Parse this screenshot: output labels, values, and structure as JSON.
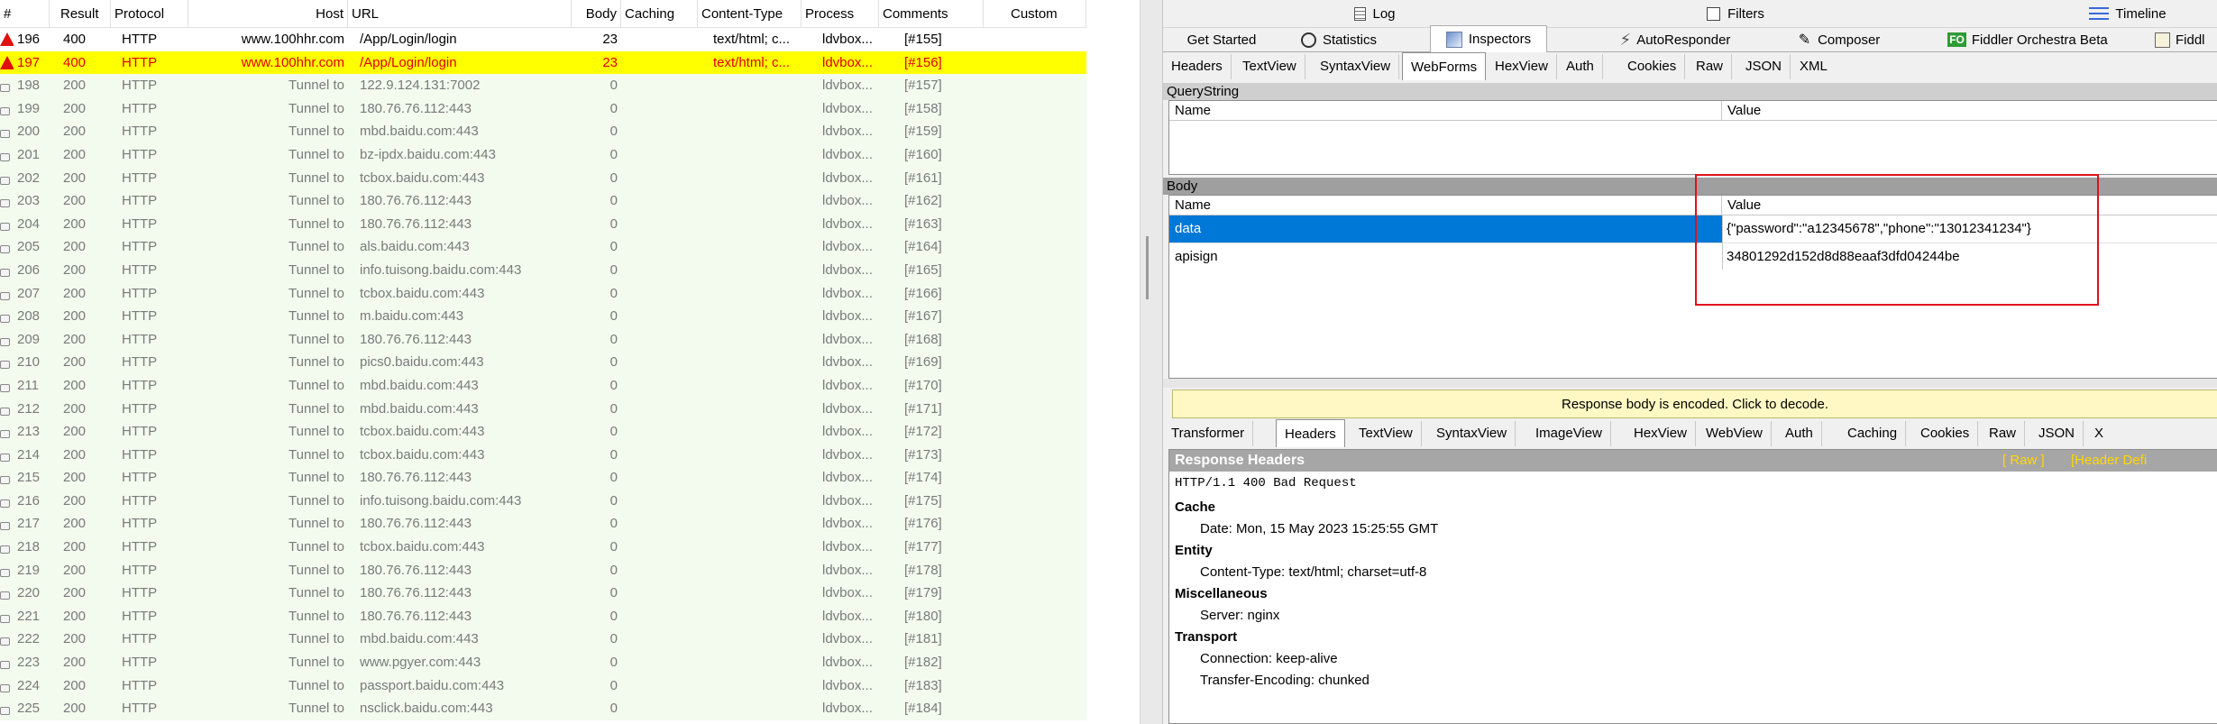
{
  "sessions": {
    "columns": [
      "#",
      "Result",
      "Protocol",
      "Host",
      "URL",
      "Body",
      "Caching",
      "Content-Type",
      "Process",
      "Comments",
      "Custom"
    ],
    "rows": [
      {
        "num": "196",
        "result": "400",
        "protocol": "HTTP",
        "host": "www.100hhr.com",
        "url": "/App/Login/login",
        "body": "23",
        "caching": "",
        "content_type": "text/html; c...",
        "process": "ldvbox...",
        "comments": "[#155]",
        "status": "error"
      },
      {
        "num": "197",
        "result": "400",
        "protocol": "HTTP",
        "host": "www.100hhr.com",
        "url": "/App/Login/login",
        "body": "23",
        "caching": "",
        "content_type": "text/html; c...",
        "process": "ldvbox...",
        "comments": "[#156]",
        "status": "selected"
      },
      {
        "num": "198",
        "result": "200",
        "protocol": "HTTP",
        "host": "Tunnel to",
        "url": "122.9.124.131:7002",
        "body": "0",
        "caching": "",
        "content_type": "",
        "process": "ldvbox...",
        "comments": "[#157]",
        "status": "tunnel"
      },
      {
        "num": "199",
        "result": "200",
        "protocol": "HTTP",
        "host": "Tunnel to",
        "url": "180.76.76.112:443",
        "body": "0",
        "caching": "",
        "content_type": "",
        "process": "ldvbox...",
        "comments": "[#158]",
        "status": "tunnel"
      },
      {
        "num": "200",
        "result": "200",
        "protocol": "HTTP",
        "host": "Tunnel to",
        "url": "mbd.baidu.com:443",
        "body": "0",
        "caching": "",
        "content_type": "",
        "process": "ldvbox...",
        "comments": "[#159]",
        "status": "tunnel"
      },
      {
        "num": "201",
        "result": "200",
        "protocol": "HTTP",
        "host": "Tunnel to",
        "url": "bz-ipdx.baidu.com:443",
        "body": "0",
        "caching": "",
        "content_type": "",
        "process": "ldvbox...",
        "comments": "[#160]",
        "status": "tunnel"
      },
      {
        "num": "202",
        "result": "200",
        "protocol": "HTTP",
        "host": "Tunnel to",
        "url": "tcbox.baidu.com:443",
        "body": "0",
        "caching": "",
        "content_type": "",
        "process": "ldvbox...",
        "comments": "[#161]",
        "status": "tunnel"
      },
      {
        "num": "203",
        "result": "200",
        "protocol": "HTTP",
        "host": "Tunnel to",
        "url": "180.76.76.112:443",
        "body": "0",
        "caching": "",
        "content_type": "",
        "process": "ldvbox...",
        "comments": "[#162]",
        "status": "tunnel"
      },
      {
        "num": "204",
        "result": "200",
        "protocol": "HTTP",
        "host": "Tunnel to",
        "url": "180.76.76.112:443",
        "body": "0",
        "caching": "",
        "content_type": "",
        "process": "ldvbox...",
        "comments": "[#163]",
        "status": "tunnel"
      },
      {
        "num": "205",
        "result": "200",
        "protocol": "HTTP",
        "host": "Tunnel to",
        "url": "als.baidu.com:443",
        "body": "0",
        "caching": "",
        "content_type": "",
        "process": "ldvbox...",
        "comments": "[#164]",
        "status": "tunnel"
      },
      {
        "num": "206",
        "result": "200",
        "protocol": "HTTP",
        "host": "Tunnel to",
        "url": "info.tuisong.baidu.com:443",
        "body": "0",
        "caching": "",
        "content_type": "",
        "process": "ldvbox...",
        "comments": "[#165]",
        "status": "tunnel"
      },
      {
        "num": "207",
        "result": "200",
        "protocol": "HTTP",
        "host": "Tunnel to",
        "url": "tcbox.baidu.com:443",
        "body": "0",
        "caching": "",
        "content_type": "",
        "process": "ldvbox...",
        "comments": "[#166]",
        "status": "tunnel"
      },
      {
        "num": "208",
        "result": "200",
        "protocol": "HTTP",
        "host": "Tunnel to",
        "url": "m.baidu.com:443",
        "body": "0",
        "caching": "",
        "content_type": "",
        "process": "ldvbox...",
        "comments": "[#167]",
        "status": "tunnel"
      },
      {
        "num": "209",
        "result": "200",
        "protocol": "HTTP",
        "host": "Tunnel to",
        "url": "180.76.76.112:443",
        "body": "0",
        "caching": "",
        "content_type": "",
        "process": "ldvbox...",
        "comments": "[#168]",
        "status": "tunnel"
      },
      {
        "num": "210",
        "result": "200",
        "protocol": "HTTP",
        "host": "Tunnel to",
        "url": "pics0.baidu.com:443",
        "body": "0",
        "caching": "",
        "content_type": "",
        "process": "ldvbox...",
        "comments": "[#169]",
        "status": "tunnel"
      },
      {
        "num": "211",
        "result": "200",
        "protocol": "HTTP",
        "host": "Tunnel to",
        "url": "mbd.baidu.com:443",
        "body": "0",
        "caching": "",
        "content_type": "",
        "process": "ldvbox...",
        "comments": "[#170]",
        "status": "tunnel"
      },
      {
        "num": "212",
        "result": "200",
        "protocol": "HTTP",
        "host": "Tunnel to",
        "url": "mbd.baidu.com:443",
        "body": "0",
        "caching": "",
        "content_type": "",
        "process": "ldvbox...",
        "comments": "[#171]",
        "status": "tunnel"
      },
      {
        "num": "213",
        "result": "200",
        "protocol": "HTTP",
        "host": "Tunnel to",
        "url": "tcbox.baidu.com:443",
        "body": "0",
        "caching": "",
        "content_type": "",
        "process": "ldvbox...",
        "comments": "[#172]",
        "status": "tunnel"
      },
      {
        "num": "214",
        "result": "200",
        "protocol": "HTTP",
        "host": "Tunnel to",
        "url": "tcbox.baidu.com:443",
        "body": "0",
        "caching": "",
        "content_type": "",
        "process": "ldvbox...",
        "comments": "[#173]",
        "status": "tunnel"
      },
      {
        "num": "215",
        "result": "200",
        "protocol": "HTTP",
        "host": "Tunnel to",
        "url": "180.76.76.112:443",
        "body": "0",
        "caching": "",
        "content_type": "",
        "process": "ldvbox...",
        "comments": "[#174]",
        "status": "tunnel"
      },
      {
        "num": "216",
        "result": "200",
        "protocol": "HTTP",
        "host": "Tunnel to",
        "url": "info.tuisong.baidu.com:443",
        "body": "0",
        "caching": "",
        "content_type": "",
        "process": "ldvbox...",
        "comments": "[#175]",
        "status": "tunnel"
      },
      {
        "num": "217",
        "result": "200",
        "protocol": "HTTP",
        "host": "Tunnel to",
        "url": "180.76.76.112:443",
        "body": "0",
        "caching": "",
        "content_type": "",
        "process": "ldvbox...",
        "comments": "[#176]",
        "status": "tunnel"
      },
      {
        "num": "218",
        "result": "200",
        "protocol": "HTTP",
        "host": "Tunnel to",
        "url": "tcbox.baidu.com:443",
        "body": "0",
        "caching": "",
        "content_type": "",
        "process": "ldvbox...",
        "comments": "[#177]",
        "status": "tunnel"
      },
      {
        "num": "219",
        "result": "200",
        "protocol": "HTTP",
        "host": "Tunnel to",
        "url": "180.76.76.112:443",
        "body": "0",
        "caching": "",
        "content_type": "",
        "process": "ldvbox...",
        "comments": "[#178]",
        "status": "tunnel"
      },
      {
        "num": "220",
        "result": "200",
        "protocol": "HTTP",
        "host": "Tunnel to",
        "url": "180.76.76.112:443",
        "body": "0",
        "caching": "",
        "content_type": "",
        "process": "ldvbox...",
        "comments": "[#179]",
        "status": "tunnel"
      },
      {
        "num": "221",
        "result": "200",
        "protocol": "HTTP",
        "host": "Tunnel to",
        "url": "180.76.76.112:443",
        "body": "0",
        "caching": "",
        "content_type": "",
        "process": "ldvbox...",
        "comments": "[#180]",
        "status": "tunnel"
      },
      {
        "num": "222",
        "result": "200",
        "protocol": "HTTP",
        "host": "Tunnel to",
        "url": "mbd.baidu.com:443",
        "body": "0",
        "caching": "",
        "content_type": "",
        "process": "ldvbox...",
        "comments": "[#181]",
        "status": "tunnel"
      },
      {
        "num": "223",
        "result": "200",
        "protocol": "HTTP",
        "host": "Tunnel to",
        "url": "www.pgyer.com:443",
        "body": "0",
        "caching": "",
        "content_type": "",
        "process": "ldvbox...",
        "comments": "[#182]",
        "status": "tunnel"
      },
      {
        "num": "224",
        "result": "200",
        "protocol": "HTTP",
        "host": "Tunnel to",
        "url": "passport.baidu.com:443",
        "body": "0",
        "caching": "",
        "content_type": "",
        "process": "ldvbox...",
        "comments": "[#183]",
        "status": "tunnel"
      },
      {
        "num": "225",
        "result": "200",
        "protocol": "HTTP",
        "host": "Tunnel to",
        "url": "nsclick.baidu.com:443",
        "body": "0",
        "caching": "",
        "content_type": "",
        "process": "ldvbox...",
        "comments": "[#184]",
        "status": "tunnel"
      }
    ]
  },
  "toolbar": {
    "log": "Log",
    "filters": "Filters",
    "timeline": "Timeline",
    "get_started": "Get Started",
    "statistics": "Statistics",
    "inspectors": "Inspectors",
    "autoresponder": "AutoResponder",
    "composer": "Composer",
    "orchestra_badge": "FO",
    "orchestra": "Fiddler Orchestra Beta",
    "fiddlerscript": "Fiddl"
  },
  "request_tabs": [
    "Headers",
    "TextView",
    "SyntaxView",
    "WebForms",
    "HexView",
    "Auth",
    "Cookies",
    "Raw",
    "JSON",
    "XML"
  ],
  "request_active_tab": "WebForms",
  "webforms": {
    "querystring_label": "QueryString",
    "querystring_cols": [
      "Name",
      "Value"
    ],
    "body_label": "Body",
    "body_cols": [
      "Name",
      "Value"
    ],
    "body_rows": [
      {
        "name": "data",
        "value": "{\"password\":\"a12345678\",\"phone\":\"13012341234\"}"
      },
      {
        "name": "apisign",
        "value": "34801292d152d8d88eaaf3dfd04244be"
      }
    ]
  },
  "response": {
    "encoded_notice": "Response body is encoded. Click to decode.",
    "tabs": [
      "Transformer",
      "Headers",
      "TextView",
      "SyntaxView",
      "ImageView",
      "HexView",
      "WebView",
      "Auth",
      "Caching",
      "Cookies",
      "Raw",
      "JSON",
      "X"
    ],
    "active_tab": "Headers",
    "headers_title": "Response Headers",
    "raw_link": "[ Raw ]",
    "header_defs_link": "[Header Defi",
    "status_line": "HTTP/1.1 400 Bad Request",
    "groups": [
      {
        "name": "Cache",
        "items": [
          "Date: Mon, 15 May 2023 15:25:55 GMT"
        ]
      },
      {
        "name": "Entity",
        "items": [
          "Content-Type: text/html; charset=utf-8"
        ]
      },
      {
        "name": "Miscellaneous",
        "items": [
          "Server: nginx"
        ]
      },
      {
        "name": "Transport",
        "items": [
          "Connection: keep-alive",
          "Transfer-Encoding: chunked"
        ]
      }
    ]
  },
  "colors": {
    "selected_row_bg": "#ffff00",
    "selected_row_text": "#e00000",
    "tunnel_row_bg": "#f2fbee",
    "body_row_selected": "#0078d7",
    "highlight_box": "#e0101a",
    "response_notice_bg": "#fff8c4",
    "headers_title_bg": "#a6a6a6",
    "header_link_color": "#ffd800"
  }
}
